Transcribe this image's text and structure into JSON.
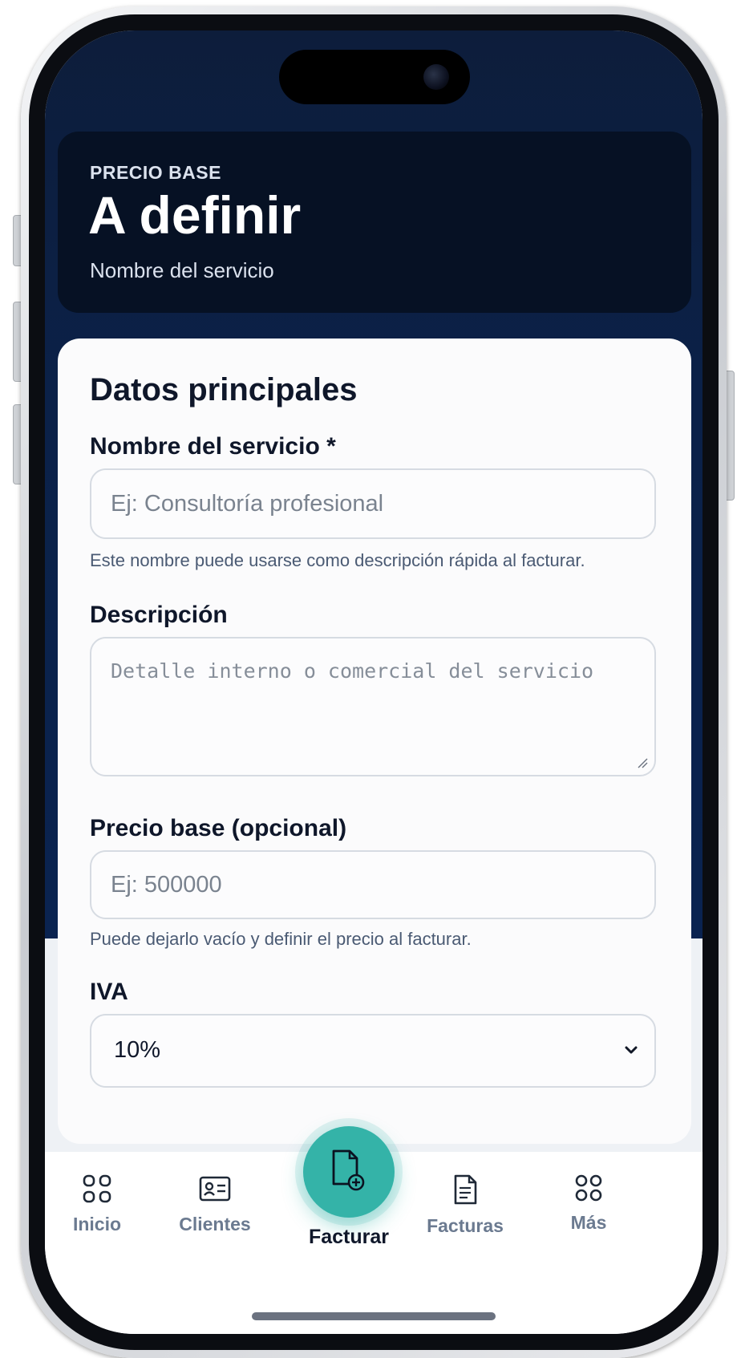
{
  "hero": {
    "eyebrow": "PRECIO BASE",
    "title": "A definir",
    "subtitle": "Nombre del servicio"
  },
  "form": {
    "section_title": "Datos principales",
    "service_name": {
      "label": "Nombre del servicio *",
      "placeholder": "Ej: Consultoría profesional",
      "value": "",
      "hint": "Este nombre puede usarse como descripción rápida al facturar."
    },
    "description": {
      "label": "Descripción",
      "placeholder": "Detalle interno o comercial del servicio",
      "value": ""
    },
    "base_price": {
      "label": "Precio base (opcional)",
      "placeholder": "Ej: 500000",
      "value": "",
      "hint": "Puede dejarlo vacío y definir el precio al facturar."
    },
    "iva": {
      "label": "IVA",
      "selected": "10%"
    }
  },
  "tabbar": {
    "items": [
      {
        "label": "Inicio",
        "icon": "grid-icon"
      },
      {
        "label": "Clientes",
        "icon": "contact-card-icon"
      },
      {
        "label": "Facturar",
        "icon": "new-invoice-icon",
        "active": true
      },
      {
        "label": "Facturas",
        "icon": "document-icon"
      },
      {
        "label": "Más",
        "icon": "more-grid-icon"
      }
    ]
  },
  "colors": {
    "header_bg": "#0a2350",
    "hero_bg": "#061124",
    "accent": "#34b3a8",
    "tab_inactive": "#6b7a90"
  }
}
